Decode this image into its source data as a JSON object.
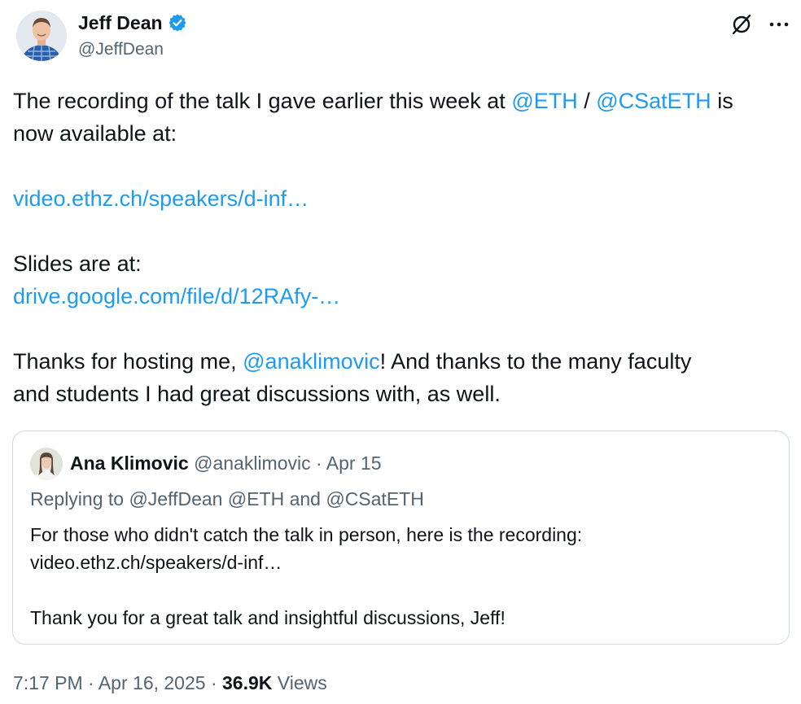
{
  "author": {
    "name": "Jeff Dean",
    "handle": "@JeffDean"
  },
  "icons": {
    "verified": "verified-badge-icon",
    "grok": "grok-icon",
    "more": "more-icon"
  },
  "colors": {
    "link": "#1d9bf0",
    "verified": "#1d9bf0",
    "secondary_text": "#536471",
    "border": "#cfd9de"
  },
  "tweet": {
    "line1_text": "The recording of the talk I gave earlier this week at ",
    "mention_eth": "@ETH",
    "separator": " / ",
    "mention_csateth": "@CSatETH",
    "line1_tail": " is",
    "line2": "now available at:",
    "video_link": "video.ethz.ch/speakers/d-inf…",
    "slides_label": "Slides are at:",
    "slides_link": "drive.google.com/file/d/12RAfy-…",
    "thanks_prefix": "Thanks for hosting me, ",
    "mention_ana": "@anaklimovic",
    "thanks_suffix": "!  And thanks to the many faculty",
    "thanks_line2": "and students I had great discussions with, as well."
  },
  "quoted": {
    "name": "Ana Klimovic",
    "handle": "@anaklimovic",
    "dot": " · ",
    "date": "Apr 15",
    "replying": "Replying to @JeffDean @ETH and @CSatETH",
    "line1": "For those who didn't catch the talk in person, here is the recording:",
    "line2": "video.ethz.ch/speakers/d-inf…",
    "line3": "Thank you for a great talk and insightful discussions, Jeff!"
  },
  "footer": {
    "time": "7:17 PM",
    "date": "Apr 16, 2025",
    "views_count": "36.9K",
    "views_label": "Views"
  }
}
